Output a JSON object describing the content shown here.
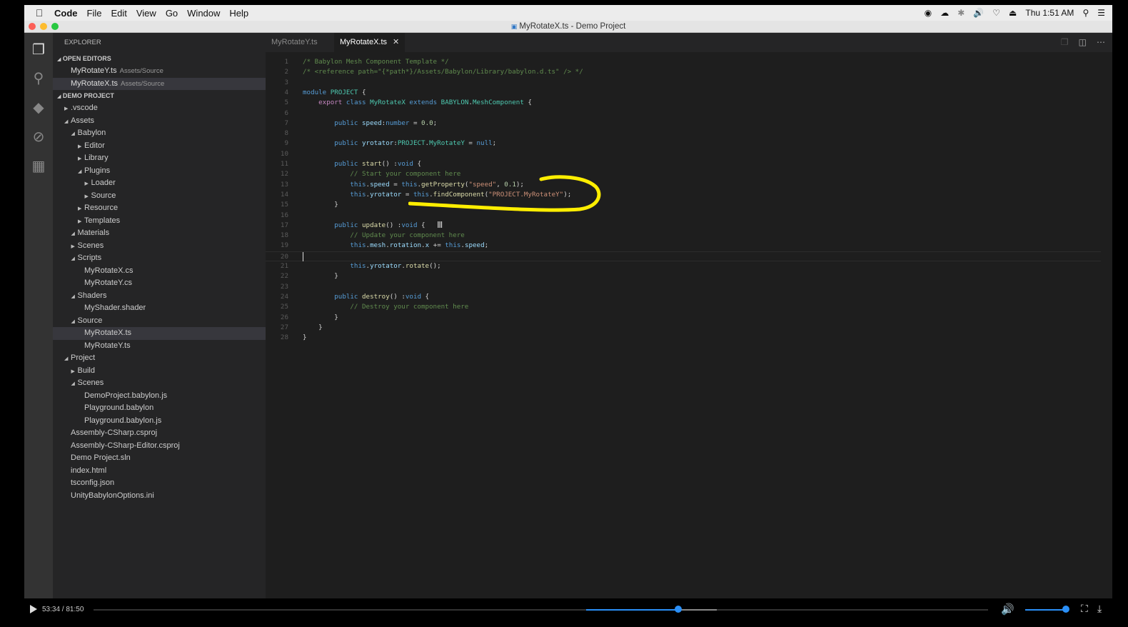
{
  "menubar": {
    "app": "Code",
    "items": [
      "File",
      "Edit",
      "View",
      "Go",
      "Window",
      "Help"
    ],
    "clock": "Thu 1:51 AM"
  },
  "window": {
    "title": "MyRotateX.ts - Demo Project"
  },
  "explorer": {
    "header": "EXPLORER",
    "open_editors_label": "OPEN EDITORS",
    "open_editors": [
      {
        "name": "MyRotateY.ts",
        "path": "Assets/Source"
      },
      {
        "name": "MyRotateX.ts",
        "path": "Assets/Source"
      }
    ],
    "project_label": "DEMO PROJECT",
    "tree": [
      {
        "label": ".vscode",
        "depth": 0,
        "twisty": "closed"
      },
      {
        "label": "Assets",
        "depth": 0,
        "twisty": "open"
      },
      {
        "label": "Babylon",
        "depth": 1,
        "twisty": "open"
      },
      {
        "label": "Editor",
        "depth": 2,
        "twisty": "closed"
      },
      {
        "label": "Library",
        "depth": 2,
        "twisty": "closed"
      },
      {
        "label": "Plugins",
        "depth": 2,
        "twisty": "open"
      },
      {
        "label": "Loader",
        "depth": 3,
        "twisty": "closed"
      },
      {
        "label": "Source",
        "depth": 3,
        "twisty": "closed"
      },
      {
        "label": "Resource",
        "depth": 2,
        "twisty": "closed"
      },
      {
        "label": "Templates",
        "depth": 2,
        "twisty": "closed"
      },
      {
        "label": "Materials",
        "depth": 1,
        "twisty": "open"
      },
      {
        "label": "Scenes",
        "depth": 1,
        "twisty": "closed"
      },
      {
        "label": "Scripts",
        "depth": 1,
        "twisty": "open"
      },
      {
        "label": "MyRotateX.cs",
        "depth": 2,
        "twisty": "none"
      },
      {
        "label": "MyRotateY.cs",
        "depth": 2,
        "twisty": "none"
      },
      {
        "label": "Shaders",
        "depth": 1,
        "twisty": "open"
      },
      {
        "label": "MyShader.shader",
        "depth": 2,
        "twisty": "none"
      },
      {
        "label": "Source",
        "depth": 1,
        "twisty": "open"
      },
      {
        "label": "MyRotateX.ts",
        "depth": 2,
        "twisty": "none",
        "selected": true
      },
      {
        "label": "MyRotateY.ts",
        "depth": 2,
        "twisty": "none"
      },
      {
        "label": "Project",
        "depth": 0,
        "twisty": "open"
      },
      {
        "label": "Build",
        "depth": 1,
        "twisty": "closed"
      },
      {
        "label": "Scenes",
        "depth": 1,
        "twisty": "open"
      },
      {
        "label": "DemoProject.babylon.js",
        "depth": 2,
        "twisty": "none"
      },
      {
        "label": "Playground.babylon",
        "depth": 2,
        "twisty": "none"
      },
      {
        "label": "Playground.babylon.js",
        "depth": 2,
        "twisty": "none"
      },
      {
        "label": "Assembly-CSharp.csproj",
        "depth": 0,
        "twisty": "none"
      },
      {
        "label": "Assembly-CSharp-Editor.csproj",
        "depth": 0,
        "twisty": "none"
      },
      {
        "label": "Demo Project.sln",
        "depth": 0,
        "twisty": "none"
      },
      {
        "label": "index.html",
        "depth": 0,
        "twisty": "none"
      },
      {
        "label": "tsconfig.json",
        "depth": 0,
        "twisty": "none"
      },
      {
        "label": "UnityBabylonOptions.ini",
        "depth": 0,
        "twisty": "none"
      }
    ]
  },
  "tabs": [
    {
      "label": "MyRotateY.ts",
      "active": false
    },
    {
      "label": "MyRotateX.ts",
      "active": true
    }
  ],
  "code": [
    [
      [
        "c",
        "/* Babylon Mesh Component Template */"
      ]
    ],
    [
      [
        "c",
        "/* <reference path=\"{*path*}/Assets/Babylon/Library/babylon.d.ts\" /> */"
      ]
    ],
    [],
    [
      [
        "k",
        "module "
      ],
      [
        "t",
        "PROJECT"
      ],
      [
        "p",
        " {"
      ]
    ],
    [
      [
        "p",
        "    "
      ],
      [
        "x",
        "export "
      ],
      [
        "k",
        "class "
      ],
      [
        "t",
        "MyRotateX "
      ],
      [
        "k",
        "extends "
      ],
      [
        "t",
        "BABYLON"
      ],
      [
        "p",
        "."
      ],
      [
        "t",
        "MeshComponent"
      ],
      [
        "p",
        " {"
      ]
    ],
    [],
    [
      [
        "p",
        "        "
      ],
      [
        "k",
        "public "
      ],
      [
        "v",
        "speed"
      ],
      [
        "p",
        ":"
      ],
      [
        "k",
        "number"
      ],
      [
        "p",
        " = "
      ],
      [
        "n",
        "0.0"
      ],
      [
        "p",
        ";"
      ]
    ],
    [],
    [
      [
        "p",
        "        "
      ],
      [
        "k",
        "public "
      ],
      [
        "v",
        "yrotator"
      ],
      [
        "p",
        ":"
      ],
      [
        "t",
        "PROJECT"
      ],
      [
        "p",
        "."
      ],
      [
        "t",
        "MyRotateY"
      ],
      [
        "p",
        " = "
      ],
      [
        "k",
        "null"
      ],
      [
        "p",
        ";"
      ]
    ],
    [],
    [
      [
        "p",
        "        "
      ],
      [
        "k",
        "public "
      ],
      [
        "f",
        "start"
      ],
      [
        "p",
        "() :"
      ],
      [
        "k",
        "void"
      ],
      [
        "p",
        " {"
      ]
    ],
    [
      [
        "p",
        "            "
      ],
      [
        "c",
        "// Start your component here"
      ]
    ],
    [
      [
        "p",
        "            "
      ],
      [
        "k",
        "this"
      ],
      [
        "p",
        "."
      ],
      [
        "v",
        "speed"
      ],
      [
        "p",
        " = "
      ],
      [
        "k",
        "this"
      ],
      [
        "p",
        "."
      ],
      [
        "f",
        "getProperty"
      ],
      [
        "p",
        "("
      ],
      [
        "s",
        "\"speed\""
      ],
      [
        "p",
        ", "
      ],
      [
        "n",
        "0.1"
      ],
      [
        "p",
        ");"
      ]
    ],
    [
      [
        "p",
        "            "
      ],
      [
        "k",
        "this"
      ],
      [
        "p",
        "."
      ],
      [
        "v",
        "yrotator"
      ],
      [
        "p",
        " = "
      ],
      [
        "k",
        "this"
      ],
      [
        "p",
        "."
      ],
      [
        "f",
        "findComponent"
      ],
      [
        "p",
        "("
      ],
      [
        "s",
        "\"PROJECT.MyRotateY\""
      ],
      [
        "p",
        ");"
      ]
    ],
    [
      [
        "p",
        "        }"
      ]
    ],
    [],
    [
      [
        "p",
        "        "
      ],
      [
        "k",
        "public "
      ],
      [
        "f",
        "update"
      ],
      [
        "p",
        "() :"
      ],
      [
        "k",
        "void"
      ],
      [
        "p",
        " {"
      ]
    ],
    [
      [
        "p",
        "            "
      ],
      [
        "c",
        "// Update your component here"
      ]
    ],
    [
      [
        "p",
        "            "
      ],
      [
        "k",
        "this"
      ],
      [
        "p",
        "."
      ],
      [
        "v",
        "mesh"
      ],
      [
        "p",
        "."
      ],
      [
        "v",
        "rotation"
      ],
      [
        "p",
        "."
      ],
      [
        "v",
        "x"
      ],
      [
        "p",
        " += "
      ],
      [
        "k",
        "this"
      ],
      [
        "p",
        "."
      ],
      [
        "v",
        "speed"
      ],
      [
        "p",
        ";"
      ]
    ],
    [],
    [
      [
        "p",
        "            "
      ],
      [
        "k",
        "this"
      ],
      [
        "p",
        "."
      ],
      [
        "v",
        "yrotator"
      ],
      [
        "p",
        "."
      ],
      [
        "f",
        "rotate"
      ],
      [
        "p",
        "();"
      ]
    ],
    [
      [
        "p",
        "        }"
      ]
    ],
    [],
    [
      [
        "p",
        "        "
      ],
      [
        "k",
        "public "
      ],
      [
        "f",
        "destroy"
      ],
      [
        "p",
        "() :"
      ],
      [
        "k",
        "void"
      ],
      [
        "p",
        " {"
      ]
    ],
    [
      [
        "p",
        "            "
      ],
      [
        "c",
        "// Destroy your component here"
      ]
    ],
    [
      [
        "p",
        "        }"
      ]
    ],
    [
      [
        "p",
        "    }"
      ]
    ],
    [
      [
        "p",
        "}"
      ]
    ]
  ],
  "player": {
    "time": "53:34 / 81:50",
    "progress": 0.654
  }
}
